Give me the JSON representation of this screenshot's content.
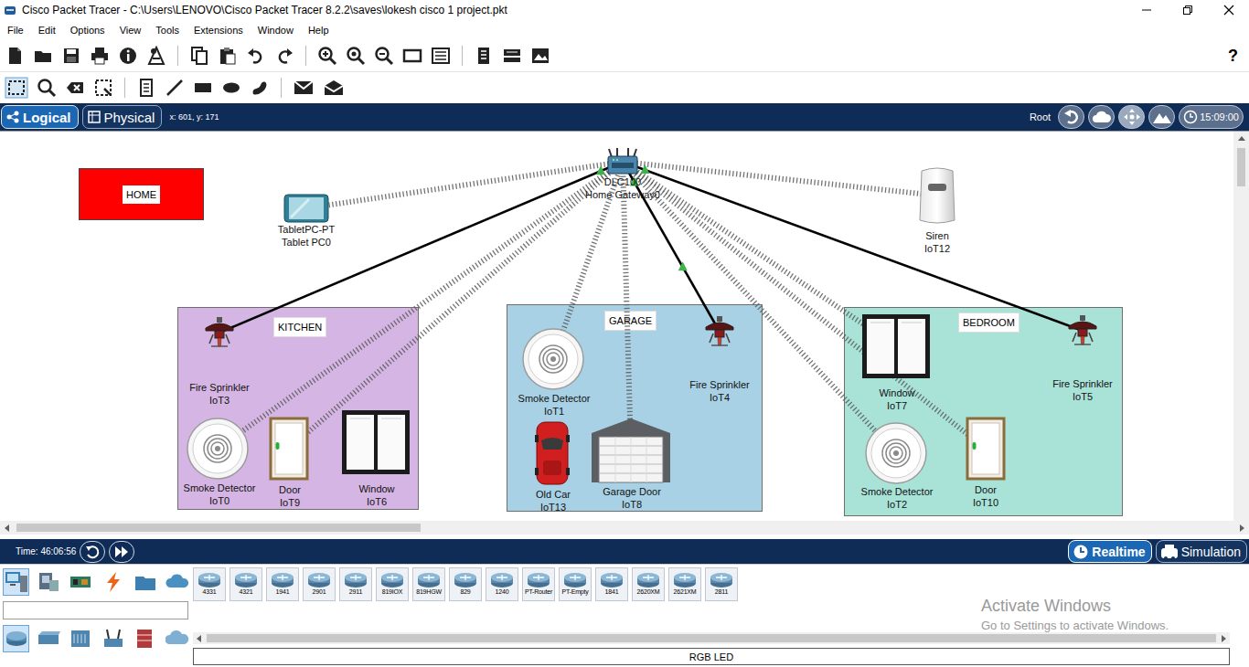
{
  "window": {
    "title": "Cisco Packet Tracer - C:\\Users\\LENOVO\\Cisco Packet Tracer 8.2.2\\saves\\lokesh cisco 1 project.pkt"
  },
  "menu": [
    "File",
    "Edit",
    "Options",
    "View",
    "Tools",
    "Extensions",
    "Window",
    "Help"
  ],
  "help": "?",
  "workspace_tabs": [
    {
      "label": "Logical",
      "selected": true
    },
    {
      "label": "Physical",
      "selected": false
    }
  ],
  "coordinates": "x: 601, y: 171",
  "navigation": {
    "path": "Root",
    "buttons": [
      {
        "selected": false
      },
      {
        "selected": false
      },
      {
        "selected": true
      },
      {
        "selected": false
      }
    ],
    "clock": "15:09:00"
  },
  "canvas": {
    "note": {
      "label": "HOME",
      "color": "#ff0000"
    },
    "rooms": [
      {
        "label": "KITCHEN",
        "color": "#d5b5e3"
      },
      {
        "label": "GARAGE",
        "color": "#a9d1e5"
      },
      {
        "label": "BEDROOM",
        "color": "#a9e3d8"
      }
    ],
    "devices": [
      {
        "name": "DLC100",
        "label": "Home Gateway0",
        "kind": "gateway"
      },
      {
        "name": "TabletPC-PT",
        "label": "Tablet PC0",
        "kind": "tablet"
      },
      {
        "name": "Siren",
        "label": "IoT12",
        "kind": "siren"
      },
      {
        "name": "Fire Sprinkler",
        "label": "IoT3",
        "kind": "sprinkler"
      },
      {
        "name": "Smoke Detector",
        "label": "IoT0",
        "kind": "smoke"
      },
      {
        "name": "Door",
        "label": "IoT9",
        "kind": "door"
      },
      {
        "name": "Window",
        "label": "IoT6",
        "kind": "window"
      },
      {
        "name": "Smoke Detector",
        "label": "IoT1",
        "kind": "smoke"
      },
      {
        "name": "Fire Sprinkler",
        "label": "IoT4",
        "kind": "sprinkler"
      },
      {
        "name": "Old Car",
        "label": "IoT13",
        "kind": "car"
      },
      {
        "name": "Garage Door",
        "label": "IoT8",
        "kind": "garage"
      },
      {
        "name": "Window",
        "label": "IoT7",
        "kind": "window"
      },
      {
        "name": "Fire Sprinkler",
        "label": "IoT5",
        "kind": "sprinkler"
      },
      {
        "name": "Smoke Detector",
        "label": "IoT2",
        "kind": "smoke"
      },
      {
        "name": "Door",
        "label": "IoT10",
        "kind": "door"
      }
    ],
    "links": [
      {
        "from": 0,
        "to": 1,
        "kind": "wireless"
      },
      {
        "from": 0,
        "to": 2,
        "kind": "wireless"
      },
      {
        "from": 0,
        "to": 3,
        "kind": "wired"
      },
      {
        "from": 0,
        "to": 4,
        "kind": "wireless"
      },
      {
        "from": 0,
        "to": 5,
        "kind": "wireless"
      },
      {
        "from": 0,
        "to": 7,
        "kind": "wireless"
      },
      {
        "from": 0,
        "to": 8,
        "kind": "wired"
      },
      {
        "from": 0,
        "to": 10,
        "kind": "wireless"
      },
      {
        "from": 0,
        "to": 11,
        "kind": "wireless"
      },
      {
        "from": 0,
        "to": 12,
        "kind": "wired"
      },
      {
        "from": 0,
        "to": 13,
        "kind": "wireless"
      },
      {
        "from": 0,
        "to": 14,
        "kind": "wireless"
      }
    ]
  },
  "time_bar": {
    "time": "Time: 46:06:56",
    "modes": [
      {
        "label": "Realtime",
        "selected": true
      },
      {
        "label": "Simulation",
        "selected": false
      }
    ]
  },
  "device_panel": {
    "categories": [
      {
        "selected": true
      },
      {
        "selected": false
      },
      {
        "selected": false
      },
      {
        "selected": false
      },
      {
        "selected": false
      },
      {
        "selected": false
      }
    ],
    "subcategories": [
      {
        "selected": true
      },
      {
        "selected": false
      },
      {
        "selected": false
      },
      {
        "selected": false
      },
      {
        "selected": false
      },
      {
        "selected": false
      }
    ],
    "models": [
      "4331",
      "4321",
      "1941",
      "2901",
      "2911",
      "819IOX",
      "819HGW",
      "829",
      "1240",
      "PT-Router",
      "PT-Empty",
      "1841",
      "2620XM",
      "2621XM",
      "2811"
    ],
    "selected_device": "RGB LED"
  },
  "watermark": {
    "title": "Activate Windows",
    "text": "Go to Settings to activate Windows."
  }
}
